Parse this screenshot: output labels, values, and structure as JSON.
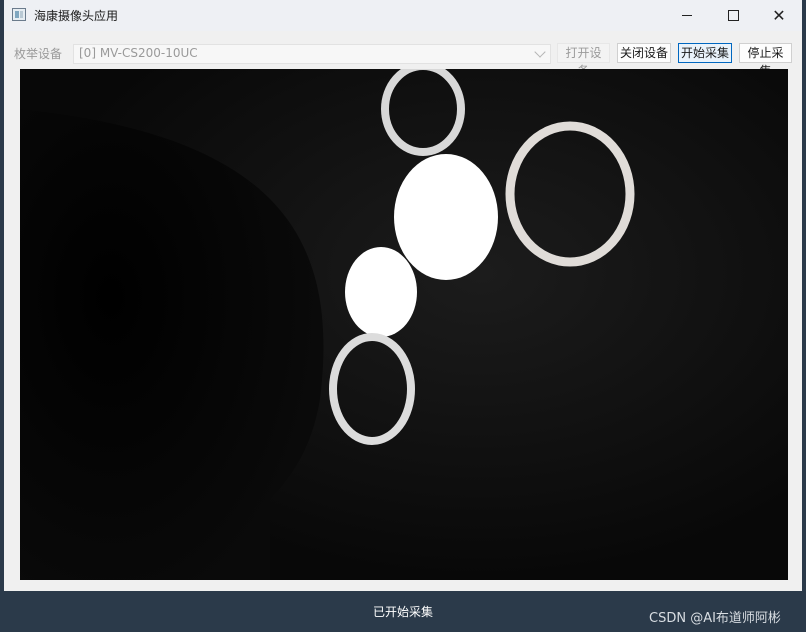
{
  "window": {
    "title": "海康摄像头应用",
    "icon": "app-window-icon",
    "controls": {
      "minimize": "minimize-icon",
      "maximize": "maximize-icon",
      "close": "close-icon"
    }
  },
  "toolbar": {
    "enum_label": "枚举设备",
    "device_selected": "[0]  MV-CS200-10UC",
    "open_label": "打开设备",
    "close_label": "关闭设备",
    "start_label": "开始采集",
    "stop_label": "停止采集"
  },
  "status": {
    "text": "已开始采集"
  },
  "watermark": "CSDN @AI布道师阿彬",
  "colors": {
    "statusbar": "#2b3a4a",
    "focus_border": "#0067c0",
    "video_bg": "#050505"
  }
}
